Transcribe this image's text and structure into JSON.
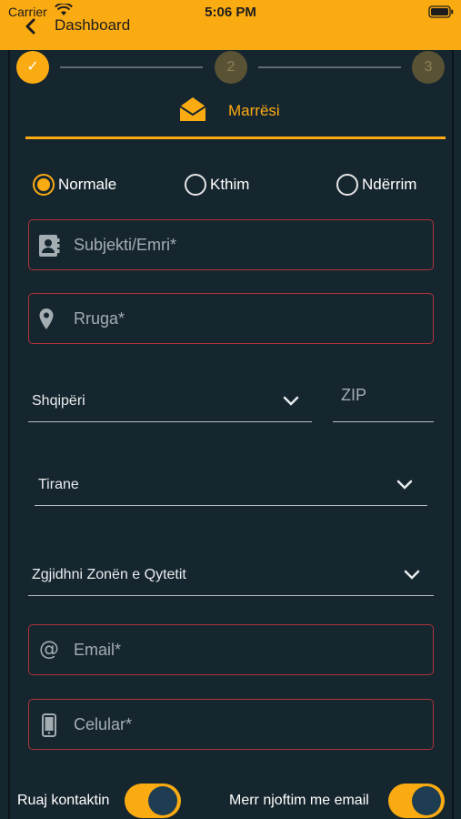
{
  "status_bar": {
    "carrier": "Carrier",
    "time": "5:06 PM"
  },
  "nav": {
    "title": "Dashboard",
    "back_icon": "chevron-left-icon"
  },
  "stepper": {
    "steps": [
      {
        "label": "✓",
        "state": "done"
      },
      {
        "label": "2",
        "state": "pending"
      },
      {
        "label": "3",
        "state": "pending"
      }
    ]
  },
  "tab": {
    "label": "Marrësi",
    "icon": "envelope-open-icon"
  },
  "delivery_type": {
    "options": [
      {
        "label": "Normale",
        "selected": true
      },
      {
        "label": "Kthim",
        "selected": false
      },
      {
        "label": "Ndërrim",
        "selected": false
      }
    ]
  },
  "form": {
    "name_placeholder": "Subjekti/Emri*",
    "street_placeholder": "Rruga*",
    "country_value": "Shqipëri",
    "zip_placeholder": "ZIP",
    "city_value": "Tirane",
    "zone_placeholder": "Zgjidhni Zonën e Qytetit",
    "email_placeholder": "Email*",
    "phone_placeholder": "Celular*"
  },
  "toggles": {
    "save_contact_label": "Ruaj kontaktin",
    "save_contact_on": true,
    "email_notify_label": "Merr njoftim me email",
    "email_notify_on": true
  },
  "colors": {
    "accent": "#fbab12",
    "background": "#16262f",
    "error_border": "#b0323c",
    "toggle_knob": "#1e3d52"
  }
}
